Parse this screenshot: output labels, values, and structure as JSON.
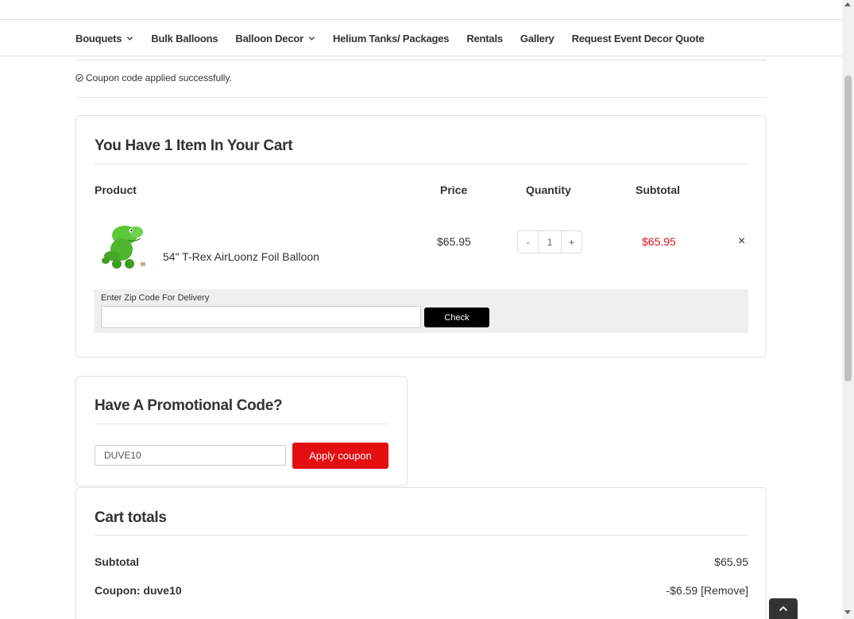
{
  "nav": {
    "items": [
      {
        "label": "Bouquets",
        "dropdown": true
      },
      {
        "label": "Bulk Balloons",
        "dropdown": false
      },
      {
        "label": "Balloon Decor",
        "dropdown": true
      },
      {
        "label": "Helium Tanks/ Packages",
        "dropdown": false
      },
      {
        "label": "Rentals",
        "dropdown": false
      },
      {
        "label": "Gallery",
        "dropdown": false
      },
      {
        "label": "Request Event Decor Quote",
        "dropdown": false
      }
    ]
  },
  "notice": {
    "message": "Coupon code applied successfully.",
    "icon": "check-circle-icon"
  },
  "cart": {
    "title": "You Have 1 Item In Your Cart",
    "columns": {
      "product": "Product",
      "price": "Price",
      "quantity": "Quantity",
      "subtotal": "Subtotal"
    },
    "items": [
      {
        "name": "54\" T-Rex AirLoonz Foil Balloon",
        "price": "$65.95",
        "quantity": "1",
        "subtotal": "$65.95",
        "image_icon": "t-rex-balloon-image"
      }
    ],
    "qty_minus": "-",
    "qty_plus": "+",
    "remove": "×",
    "zip": {
      "label": "Enter Zip Code For Delivery",
      "value": "",
      "button": "Check"
    }
  },
  "promo": {
    "title": "Have A Promotional Code?",
    "code_value": "DUVE10",
    "button": "Apply coupon"
  },
  "totals": {
    "title": "Cart totals",
    "rows": [
      {
        "label": "Subtotal",
        "value": "$65.95"
      },
      {
        "label": "Coupon: duve10",
        "value": "-$6.59 [Remove]"
      }
    ]
  },
  "colors": {
    "accent_red": "#e40f10",
    "subtotal_red": "#d9121b",
    "check_button": "#000000"
  }
}
